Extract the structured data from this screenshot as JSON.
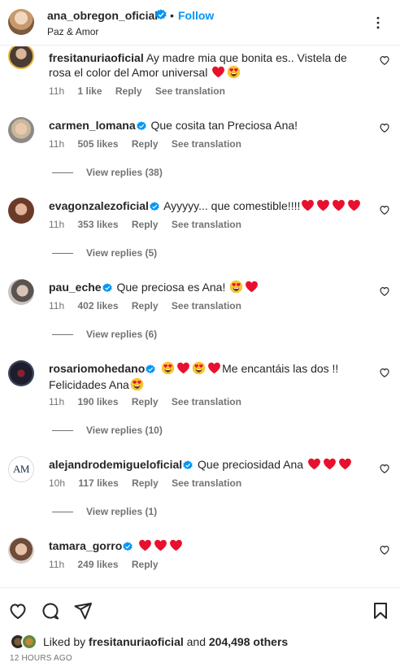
{
  "post": {
    "username": "ana_obregon_oficial",
    "separator": "•",
    "follow_label": "Follow",
    "subtitle": "Paz & Amor"
  },
  "labels": {
    "reply": "Reply",
    "see_translation": "See translation"
  },
  "comments": [
    {
      "user": "fresitanuriaoficial",
      "text": "Ay madre mia que bonita es.. Vistela de rosa el color del Amor universal",
      "emojis": [
        "heart",
        "heart-eyes"
      ],
      "time": "11h",
      "likes": "1 like",
      "replies": ""
    },
    {
      "user": "carmen_lomana",
      "text": "Que cosita tan Preciosa Ana!",
      "emojis": [],
      "time": "11h",
      "likes": "505 likes",
      "replies": "View replies (38)"
    },
    {
      "user": "evagonzalezoficial",
      "text": "Ayyyyy... que comestible!!!!",
      "emojis": [
        "heart",
        "heart",
        "heart",
        "heart"
      ],
      "time": "11h",
      "likes": "353 likes",
      "replies": "View replies (5)"
    },
    {
      "user": "pau_eche",
      "text": "Que preciosa es Ana!",
      "emojis": [
        "heart-eyes",
        "heart"
      ],
      "time": "11h",
      "likes": "402 likes",
      "replies": "View replies (6)"
    },
    {
      "user": "rosariomohedano",
      "text_before": "",
      "emojis_before": [
        "heart-eyes",
        "heart",
        "heart-eyes",
        "heart"
      ],
      "text": "Me encantáis las dos !! Felicidades Ana",
      "emojis": [
        "heart-eyes"
      ],
      "time": "11h",
      "likes": "190 likes",
      "replies": "View replies (10)"
    },
    {
      "user": "alejandrodemigueloficial",
      "text": "Que preciosidad Ana",
      "emojis": [
        "heart",
        "heart",
        "heart"
      ],
      "time": "10h",
      "likes": "117 likes",
      "replies": "View replies (1)",
      "avatar_text": "AM"
    },
    {
      "user": "tamara_gorro",
      "text": "",
      "emojis": [
        "heart",
        "heart",
        "heart"
      ],
      "time": "11h",
      "likes": "249 likes",
      "replies": ""
    }
  ],
  "likes_summary": {
    "prefix": "Liked by",
    "user": "fresitanuriaoficial",
    "and": "and",
    "others": "204,498 others"
  },
  "timestamp": "12 HOURS AGO",
  "colors": {
    "accent": "#0095f6",
    "verified": "#0095f6",
    "heart_emoji": "#e8112d",
    "secondary_text": "#737373"
  },
  "icons": {
    "more": "more-horizontal-icon",
    "comment_like": "heart-outline-icon",
    "like": "heart-outline-icon",
    "comment": "comment-bubble-icon",
    "share": "paper-plane-icon",
    "save": "bookmark-icon",
    "verified": "verified-badge-icon"
  }
}
